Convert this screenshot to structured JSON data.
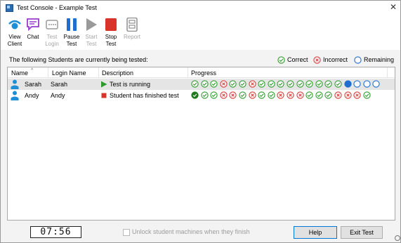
{
  "window": {
    "title": "Test Console - Example Test"
  },
  "toolbar": {
    "buttons": [
      {
        "label": "View\nClient",
        "icon": "view-client-icon",
        "enabled": true
      },
      {
        "label": "Chat",
        "icon": "chat-icon",
        "enabled": true
      },
      {
        "label": "Test\nLogin",
        "icon": "test-login-icon",
        "enabled": false
      },
      {
        "label": "Pause\nTest",
        "icon": "pause-icon",
        "enabled": true
      },
      {
        "label": "Start\nTest",
        "icon": "play-icon",
        "enabled": false
      },
      {
        "label": "Stop\nTest",
        "icon": "stop-icon",
        "enabled": true
      },
      {
        "label": "Report",
        "icon": "report-icon",
        "enabled": false
      }
    ]
  },
  "main": {
    "subtitle": "The following Students are currently being tested:",
    "legend": {
      "correct": "Correct",
      "incorrect": "Incorrect",
      "remaining": "Remaining"
    },
    "columns": {
      "name": "Name",
      "login": "Login Name",
      "description": "Description",
      "progress": "Progress"
    },
    "rows": [
      {
        "name": "Sarah",
        "login": "Sarah",
        "status": "running",
        "description": "Test is running",
        "progress": [
          "correct",
          "correct",
          "correct",
          "incorrect",
          "correct",
          "correct",
          "incorrect",
          "correct",
          "correct",
          "correct",
          "correct",
          "correct",
          "correct",
          "correct",
          "correct",
          "correct",
          "current",
          "remaining",
          "remaining",
          "remaining"
        ]
      },
      {
        "name": "Andy",
        "login": "Andy",
        "status": "finished",
        "description": "Student has finished test",
        "progress": [
          "first-correct",
          "correct",
          "correct",
          "incorrect",
          "incorrect",
          "correct",
          "incorrect",
          "correct",
          "correct",
          "incorrect",
          "incorrect",
          "incorrect",
          "correct",
          "correct",
          "correct",
          "incorrect",
          "incorrect",
          "incorrect",
          "correct"
        ]
      }
    ]
  },
  "footer": {
    "timer": "07:56",
    "unlock_label": "Unlock student machines when they finish",
    "help_label": "Help",
    "exit_label": "Exit Test"
  },
  "colors": {
    "correct": "#2e9b2e",
    "incorrect": "#d83a3a",
    "remaining": "#1e6fd0",
    "accent": "#1e6fd0",
    "stop": "#d9342b",
    "chat": "#9b3bd1"
  }
}
